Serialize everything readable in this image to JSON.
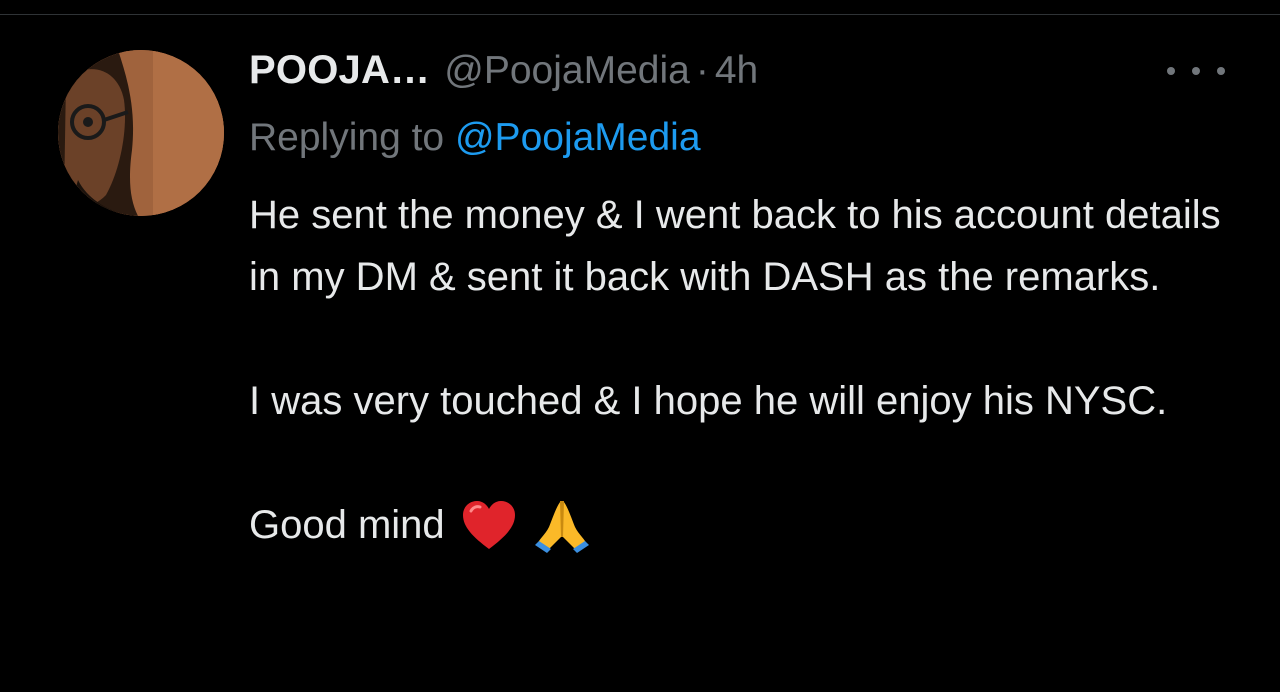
{
  "tweet": {
    "display_name": "POOJA…",
    "handle": "@PoojaMedia",
    "separator": "·",
    "time": "4h",
    "replying_label": "Replying to",
    "replying_handle": "@PoojaMedia",
    "body": {
      "paragraph_1": "He sent the money & I went back to his account details in my DM & sent it back with DASH as the remarks.",
      "paragraph_2": "I was very touched & I hope he will enjoy his NYSC.",
      "paragraph_3": "Good mind"
    },
    "emojis": [
      "red-heart-icon",
      "folded-hands-icon"
    ]
  },
  "colors": {
    "background": "#000000",
    "primary_text": "#e7e9ea",
    "secondary_text": "#71767b",
    "link": "#1d9bf0",
    "heart": "#e0242b",
    "hands": "#fbb928"
  },
  "icons": {
    "more": "more-horizontal-icon"
  }
}
